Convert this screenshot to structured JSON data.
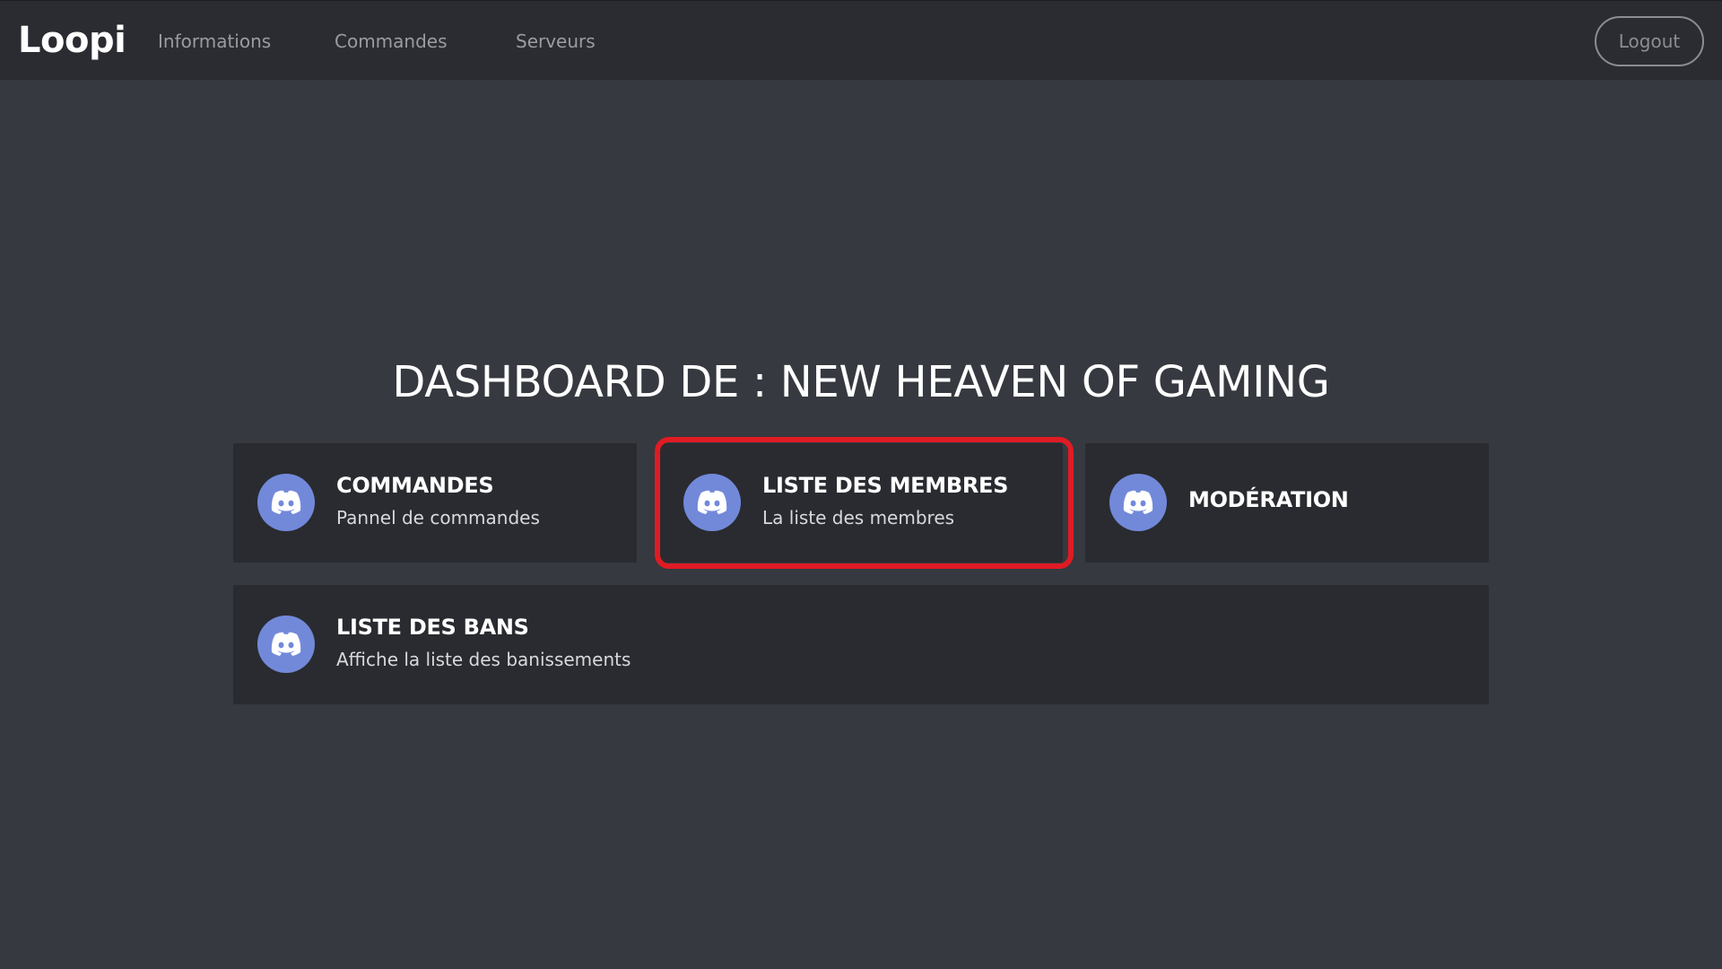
{
  "nav": {
    "brand": "Loopi",
    "links": [
      "Informations",
      "Commandes",
      "Serveurs"
    ],
    "logout_label": "Logout"
  },
  "main": {
    "title": "DASHBOARD DE : NEW HEAVEN OF GAMING",
    "cards": [
      {
        "title": "COMMANDES",
        "description": "Pannel de commandes",
        "icon": "discord-icon"
      },
      {
        "title": "LISTE DES MEMBRES",
        "description": "La liste des membres",
        "icon": "discord-icon",
        "highlighted": true
      },
      {
        "title": "MODÉRATION",
        "description": "",
        "icon": "discord-icon"
      },
      {
        "title": "LISTE DES BANS",
        "description": "Affiche la liste des banissements",
        "icon": "discord-icon"
      }
    ]
  },
  "colors": {
    "background": "#36393f",
    "navbar": "#2b2c31",
    "card": "#2a2b30",
    "discord_blurple": "#7289da",
    "highlight_red": "#e01b24"
  }
}
